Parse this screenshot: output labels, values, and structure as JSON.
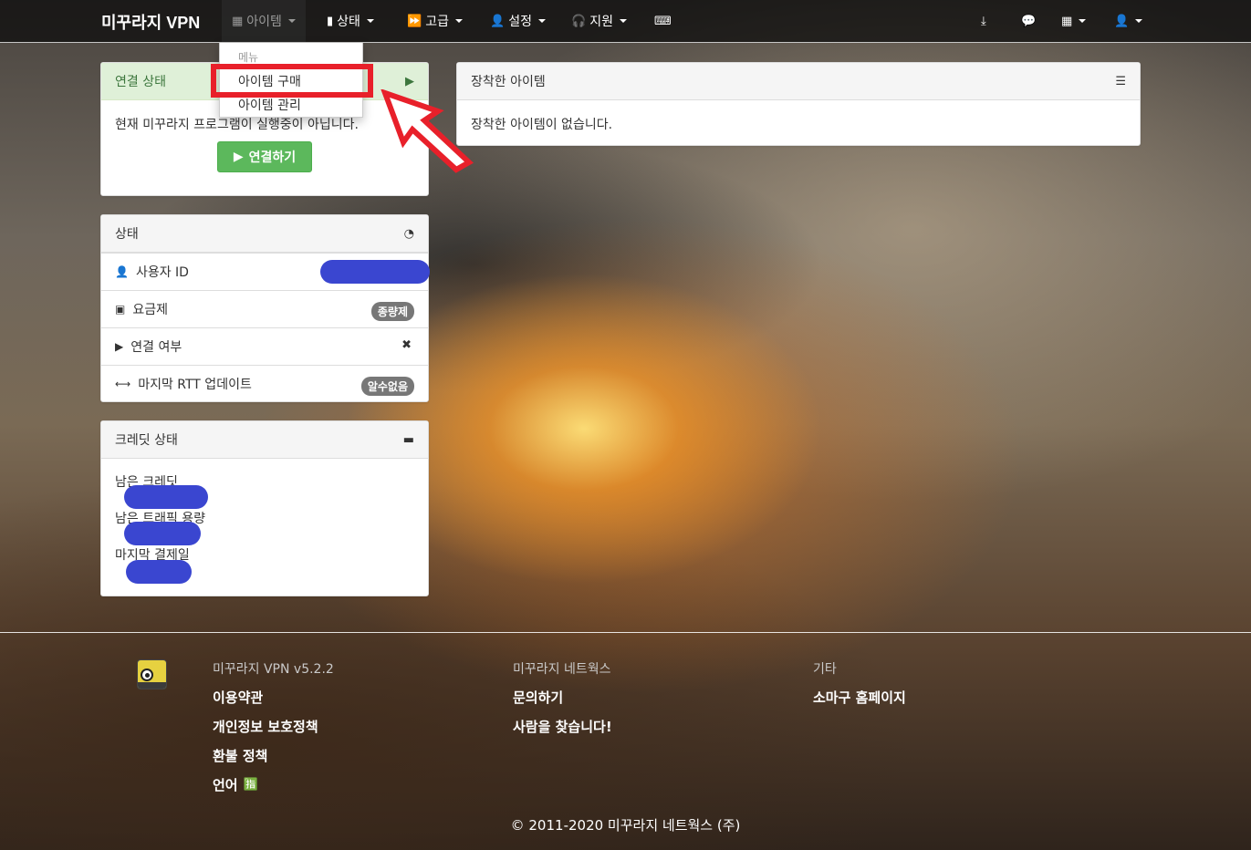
{
  "nav": {
    "brand": "미꾸라지 VPN",
    "items": [
      {
        "icon": "gift-icon",
        "label": "아이템"
      },
      {
        "icon": "bar-chart-icon",
        "label": "상태"
      },
      {
        "icon": "fast-forward-icon",
        "label": "고급"
      },
      {
        "icon": "user-icon",
        "label": "설정"
      },
      {
        "icon": "headphones-icon",
        "label": "지원"
      }
    ],
    "right_icons": [
      "download-icon",
      "comment-icon",
      "grid-icon",
      "user-icon"
    ]
  },
  "dropdown": {
    "header": "메뉴",
    "items": [
      "아이템 구매",
      "아이템 관리"
    ]
  },
  "connection_panel": {
    "title": "연결 상태",
    "message": "현재 미꾸라지 프로그램이 실행중이 아닙니다.",
    "button": "연결하기"
  },
  "equipped_panel": {
    "title": "장착한 아이템",
    "message": "장착한 아이템이 없습니다."
  },
  "status_panel": {
    "title": "상태",
    "rows": [
      {
        "icon": "user-icon",
        "label": "사용자 ID",
        "value": ""
      },
      {
        "icon": "money-icon",
        "label": "요금제",
        "value": "종량제"
      },
      {
        "icon": "play-icon",
        "label": "연결 여부",
        "value": "✖"
      },
      {
        "icon": "resize-horizontal-icon",
        "label": "마지막 RTT 업데이트",
        "value": "알수없음"
      }
    ]
  },
  "credit_panel": {
    "title": "크레딧 상태",
    "labels": [
      "남은 크레딧",
      "남은 트래픽 용량",
      "마지막 결제일"
    ]
  },
  "footer": {
    "col1_title": "미꾸라지 VPN v5.2.2",
    "col1_links": [
      "이용약관",
      "개인정보 보호정책",
      "환불 정책",
      "언어"
    ],
    "col2_title": "미꾸라지 네트웍스",
    "col2_links": [
      "문의하기",
      "사람을 찾습니다!"
    ],
    "col3_title": "기타",
    "col3_links": [
      "소마구 홈페이지"
    ],
    "copyright": "© 2011-2020 미꾸라지 네트웍스 (주)"
  },
  "colors": {
    "highlight": "#e8202a",
    "success": "#5cb85c",
    "redaction": "#3a46d0"
  }
}
